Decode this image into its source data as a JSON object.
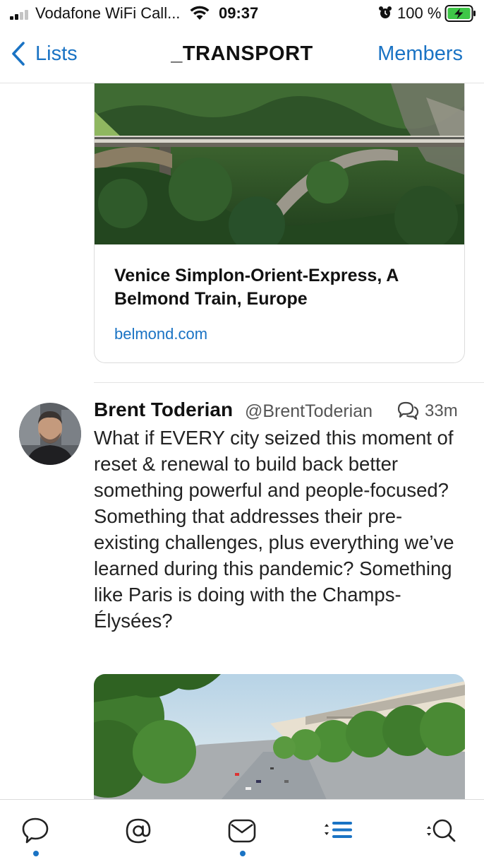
{
  "status_bar": {
    "carrier": "Vodafone WiFi Call...",
    "time": "09:37",
    "battery": "100 %",
    "icons": [
      "signal-icon",
      "wifi-icon",
      "alarm-icon",
      "battery-charging-icon"
    ]
  },
  "nav": {
    "back_label": "Lists",
    "title": "_TRANSPORT",
    "members_label": "Members"
  },
  "link_card": {
    "title": "Venice Simplon-Orient-Express, A Belmond Train, Europe",
    "domain": "belmond.com"
  },
  "tweet": {
    "author_name": "Brent Toderian",
    "author_handle": "@BrentToderian",
    "time": "33m",
    "text": "What if EVERY city seized this moment of reset & renewal to build back better something powerful and people-focused? Something that addresses their pre-existing challenges, plus everything we’ve learned during this pandemic? Something like Paris is doing with the Champs-Élysées?"
  },
  "tab_bar": {
    "tabs": [
      {
        "icon": "speech-bubble-icon",
        "dot": true
      },
      {
        "icon": "at-sign-icon",
        "dot": false
      },
      {
        "icon": "envelope-icon",
        "dot": true
      },
      {
        "icon": "lists-icon",
        "dot": false,
        "active": true
      },
      {
        "icon": "search-icon",
        "dot": false
      }
    ]
  },
  "colors": {
    "accent": "#1a73c4",
    "text": "#111111",
    "secondary_text": "#555555"
  }
}
